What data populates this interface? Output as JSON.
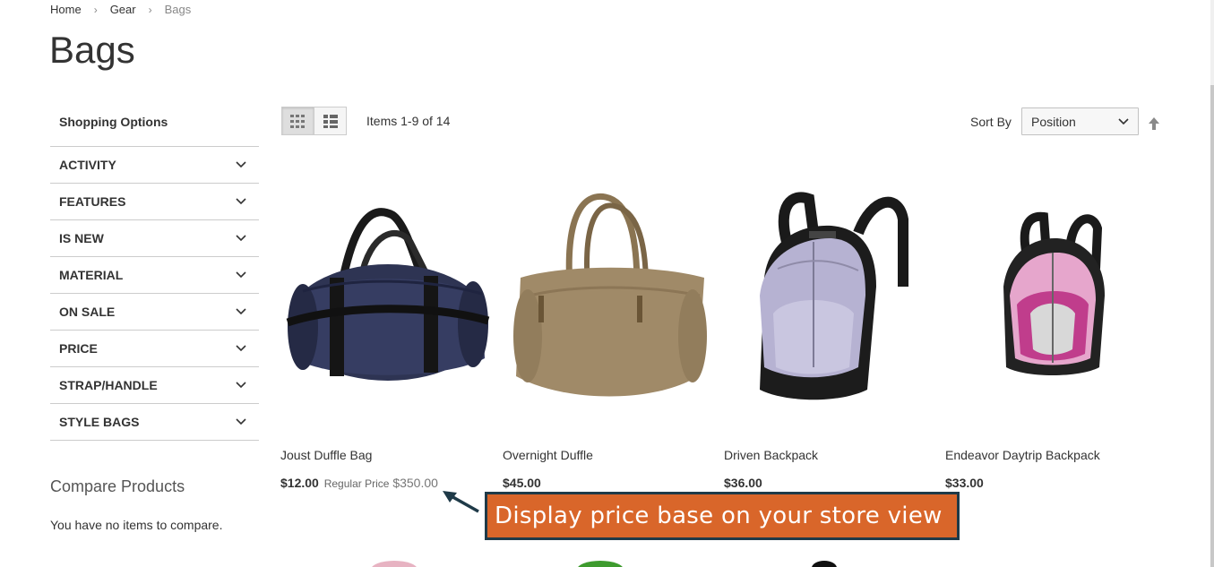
{
  "breadcrumb": {
    "home": "Home",
    "gear": "Gear",
    "current": "Bags"
  },
  "page": {
    "title": "Bags"
  },
  "sidebar": {
    "heading": "Shopping Options",
    "filters": [
      "ACTIVITY",
      "FEATURES",
      "IS NEW",
      "MATERIAL",
      "ON SALE",
      "PRICE",
      "STRAP/HANDLE",
      "STYLE BAGS"
    ],
    "compare_title": "Compare Products",
    "compare_empty": "You have no items to compare."
  },
  "toolbar": {
    "amount": "Items 1-9 of 14",
    "sort_label": "Sort By",
    "sort_value": "Position",
    "grid_icon": "grid-icon",
    "list_icon": "list-icon"
  },
  "products": [
    {
      "name": "Joust Duffle Bag",
      "price": "$12.00",
      "regular_label": "Regular Price",
      "regular_price": "$350.00"
    },
    {
      "name": "Overnight Duffle",
      "price": "$45.00"
    },
    {
      "name": "Driven Backpack",
      "price": "$36.00"
    },
    {
      "name": "Endeavor Daytrip Backpack",
      "price": "$33.00"
    }
  ],
  "annotation": {
    "text": "Display price base on your store view",
    "color": "#d9662a",
    "border": "#1f3a48"
  }
}
